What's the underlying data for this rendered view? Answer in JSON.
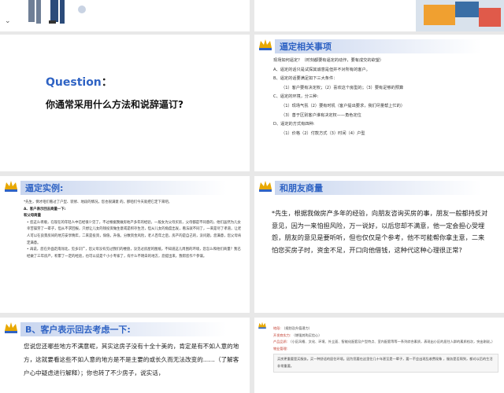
{
  "slides": {
    "s1": {
      "q_label": "Question",
      "q_colon": "：",
      "q_body": "你通常采用什么方法和说辞逼订?"
    },
    "s2": {
      "title": "逼定相关事项",
      "lines": [
        "现场如何逼定？（时刻都要有逼定的动作，要有成交的欲望）",
        "A、逼定的话只是试探其诚意是但并不对所有的客户。",
        "B、逼定的话要满足如下三大条件：",
        "（1）客户要有决定权；（2）喜欢这个房型的；（3）要有足够的预算",
        "C、逼定的环境，分三种:",
        "（1）现场气氛（2）要有时机（客户提出要求，我们尽量帮上忙的）",
        "（3）善于区别客户谁有决定权——角色定位",
        "D、逼定的方式有四种:",
        "（1）价格（2）付款方式（3）时间（4）户型"
      ]
    },
    "s3": {
      "title": "逼定实例:",
      "intro": "*先生，倒才咱们看过了户型、装修、地段的情况，您也很满意 的，那咱们今天就把它定下来吧。",
      "subhead": "A、客户表示回去商量一下:",
      "sub2": "和父母商量",
      "paras": [
        "• 您这么孝顺，在现在的年轻人中已经很少见了，不过根据我做房地产多年的经验，一般女为父母买房，父母都是不同意的，他们虽然为儿女幸苦操劳了一辈子，但从不求回报，只想让儿女的钱投资做生意或是积存生活，但从儿女的角度出发，看法就不同了，一来是尽了孝道，让老人可以在良景房间的地方安享晚年，二来是投资，保值，升值。分数资金风险，老人百年之后，房产的是自己的，没问题，您满意，您父母肯定满意。",
        "• 再说，您在外面走南闯北，见多识广，您父母没有见过我们的楼盘，没见过房屋的图纸，不知道这儿周围的环境，您怎么和他们商量？我已经做了三年房产，积累了一定的经验，也可以说是个小小专家了，有什么不明白的地方，您提出来，我帮您作个参谋。"
      ]
    },
    "s4": {
      "title": "和朋友商量",
      "body": "*先生，根据我做房产多年的经验，向朋友咨询买房的事，朋友一般都持反对意见，因为一来怕担风险，万一说好，以后您却不满意，他一定会担心受埋怨，朋友的意见是要听听，但也仅仅是个参考，他不可能帮你拿主意，二来怕您买房子时，资金不足，开口向他借钱，这种代这种心理很正常?"
    },
    "s5": {
      "title": "B、客户表示回去考虑一下:",
      "body": "您说您还哪些地方不满意呢，其实这房子没有十全十美的，肯定是有不如人意的地方，这就要看这些不如人意的地方是不是主要的或长久而无法改变的……（了解客户心中疑虑进行解释）；你也转了不少房子，说实话，"
    },
    "s6": {
      "l1k": "地段:",
      "l1v": "（规划及升值潜力）",
      "l2k": "开发商实力:",
      "l2v": "（增强其购买信心）",
      "l3k": "产品品质:",
      "l3v": "（小区风格、文化、环境、外立面、智能化配套及户型特点、室内配套等等一系列综合素质，表现出小区的居住人群的素质档次，突出刚说。）",
      "l4k": "物业管理:",
      "box": "买房更重要是买服务。买一种舒适的居住环境。因为您要在这里住几十年甚至是一辈子，要一不会出现乱收费现象 ，服务是否周到，都对以后的生活非常重要。"
    },
    "colors": {
      "accent": "#2f63c4",
      "gold": "#e8a800",
      "red": "#c0392b"
    }
  }
}
